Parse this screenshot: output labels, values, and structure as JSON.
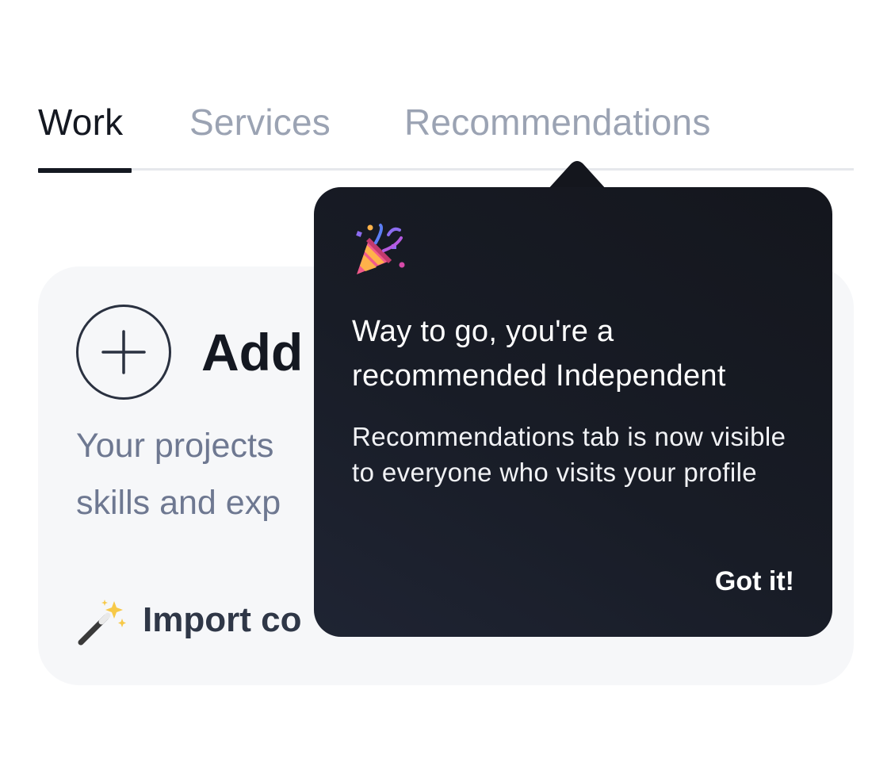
{
  "tabs": [
    {
      "label": "Work",
      "active": true
    },
    {
      "label": "Services",
      "active": false
    },
    {
      "label": "Recommendations",
      "active": false
    }
  ],
  "card": {
    "title": "Add",
    "description": "Your projects skills and exp",
    "import_label": "Import co",
    "add_icon": "plus-circle-icon",
    "import_icon": "magic-wand-icon"
  },
  "tooltip": {
    "icon": "party-popper-icon",
    "title": "Way to go, you're a recommended Independent",
    "body": "Recommendations tab is now visible to everyone who visits your profile",
    "button_label": "Got it!"
  },
  "colors": {
    "tab_active": "#141821",
    "tab_inactive": "#9ba3b3",
    "card_bg": "#f6f7f9",
    "tooltip_bg": "#181c26",
    "text_muted": "#6e7891"
  }
}
